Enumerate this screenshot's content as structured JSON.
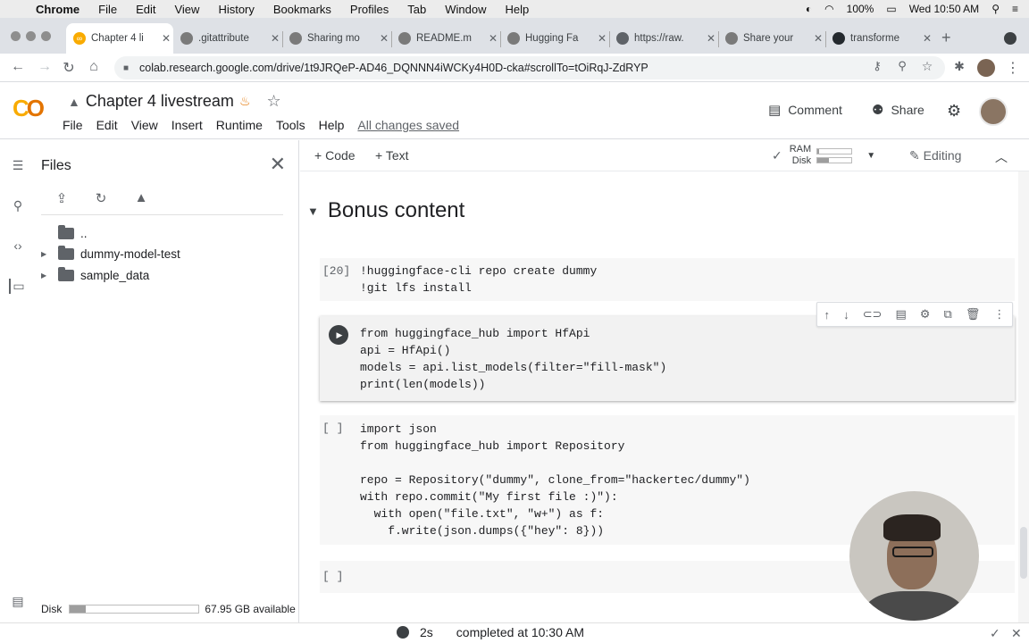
{
  "macmenu": {
    "app": "Chrome",
    "items": [
      "File",
      "Edit",
      "View",
      "History",
      "Bookmarks",
      "Profiles",
      "Tab",
      "Window",
      "Help"
    ],
    "battery": "100%",
    "clock": "Wed 10:50 AM"
  },
  "tabs": [
    {
      "title": "Chapter 4 li",
      "icon": "colab-icon"
    },
    {
      "title": ".gitattribute",
      "icon": "hf-icon"
    },
    {
      "title": "Sharing mo",
      "icon": "hf-icon"
    },
    {
      "title": "README.m",
      "icon": "hf-icon"
    },
    {
      "title": "Hugging Fa",
      "icon": "hf-icon"
    },
    {
      "title": "https://raw.",
      "icon": "globe-icon"
    },
    {
      "title": "Share your",
      "icon": "hf-icon"
    },
    {
      "title": "transforme",
      "icon": "github-icon"
    }
  ],
  "address": {
    "url": "colab.research.google.com/drive/1t9JRQeP-AD46_DQNNN4iWCKy4H0D-cka#scrollTo=tOiRqJ-ZdRYP"
  },
  "colab": {
    "title": "Chapter 4 livestream",
    "menus": [
      "File",
      "Edit",
      "View",
      "Insert",
      "Runtime",
      "Tools",
      "Help"
    ],
    "saved": "All changes saved",
    "comment": "Comment",
    "share": "Share"
  },
  "files": {
    "title": "Files",
    "parent": "..",
    "folders": [
      "dummy-model-test",
      "sample_data"
    ],
    "disk_label": "Disk",
    "disk_available": "67.95 GB available",
    "disk_used_fraction": 0.12
  },
  "toolbar": {
    "code": "Code",
    "text": "Text",
    "ram": "RAM",
    "disk": "Disk",
    "ram_fraction": 0.05,
    "disk_fraction": 0.35,
    "editing": "Editing"
  },
  "notebook": {
    "section": "Bonus content",
    "cells": [
      {
        "prompt": "[20]",
        "lines": [
          "!huggingface-cli repo create dummy",
          "!git lfs install"
        ]
      },
      {
        "prompt": "",
        "lines": [
          "from huggingface_hub import HfApi",
          "api = HfApi()",
          "models = api.list_models(filter=\"fill-mask\")",
          "print(len(models))"
        ]
      },
      {
        "prompt": "[ ]",
        "lines": [
          "import json",
          "from huggingface_hub import Repository",
          "",
          "repo = Repository(\"dummy\", clone_from=\"hackertec/dummy\")",
          "with repo.commit(\"My first file :)\"):",
          "  with open(\"file.txt\", \"w+\") as f:",
          "    f.write(json.dumps({\"hey\": 8}))"
        ]
      },
      {
        "prompt": "[ ]",
        "lines": []
      }
    ]
  },
  "status": {
    "duration": "2s",
    "completed": "completed at 10:30 AM"
  }
}
